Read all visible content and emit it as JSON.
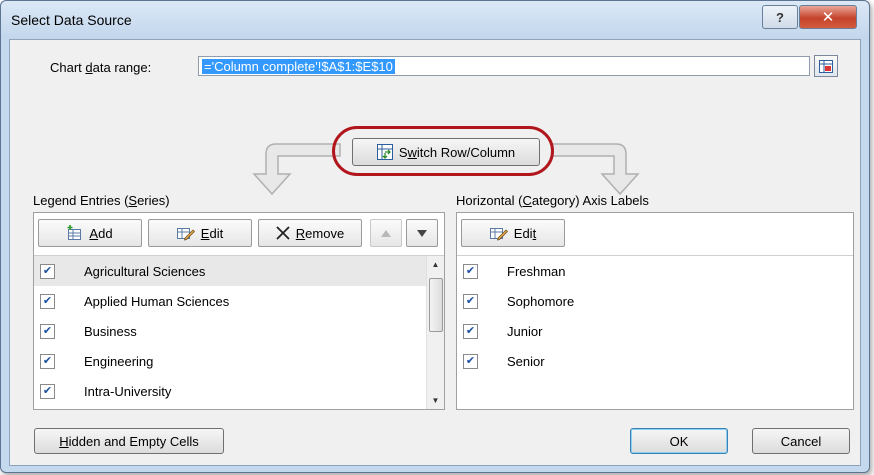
{
  "window": {
    "title": "Select Data Source",
    "help_label": "?",
    "close_label": "✕"
  },
  "range": {
    "label_pre": "Chart ",
    "label_u": "d",
    "label_post": "ata range:",
    "value": "='Column complete'!$A$1:$E$10"
  },
  "switch_button": {
    "pre": "S",
    "u": "w",
    "post": "itch Row/Column"
  },
  "legend": {
    "label_pre": "Legend Entries (",
    "label_u": "S",
    "label_post": "eries)",
    "add": {
      "u": "A",
      "post": "dd"
    },
    "edit": {
      "u": "E",
      "post": "dit"
    },
    "remove": {
      "u": "R",
      "post": "emove"
    },
    "items": [
      {
        "label": "Agricultural Sciences",
        "checked": true,
        "selected": true
      },
      {
        "label": "Applied Human Sciences",
        "checked": true,
        "selected": false
      },
      {
        "label": "Business",
        "checked": true,
        "selected": false
      },
      {
        "label": "Engineering",
        "checked": true,
        "selected": false
      },
      {
        "label": "Intra-University",
        "checked": true,
        "selected": false
      }
    ]
  },
  "axis": {
    "label_pre": "Horizontal (",
    "label_u": "C",
    "label_post": "ategory) Axis Labels",
    "edit": {
      "pre": "Edi",
      "u": "t",
      "post": ""
    },
    "items": [
      {
        "label": "Freshman",
        "checked": true
      },
      {
        "label": "Sophomore",
        "checked": true
      },
      {
        "label": "Junior",
        "checked": true
      },
      {
        "label": "Senior",
        "checked": true
      }
    ]
  },
  "footer": {
    "hidden": {
      "u": "H",
      "post": "idden and Empty Cells"
    },
    "ok": "OK",
    "cancel": "Cancel"
  },
  "icons": {
    "range_picker": "range-picker-icon",
    "switch": "switch-row-column-icon",
    "add": "add-series-icon",
    "edit": "edit-icon",
    "remove": "remove-x-icon",
    "move_up": "triangle-up-icon",
    "move_down": "triangle-down-icon"
  },
  "colors": {
    "highlight": "#b1161d",
    "titlebar": "#c5d9ee",
    "check": "#1a4fa0"
  }
}
